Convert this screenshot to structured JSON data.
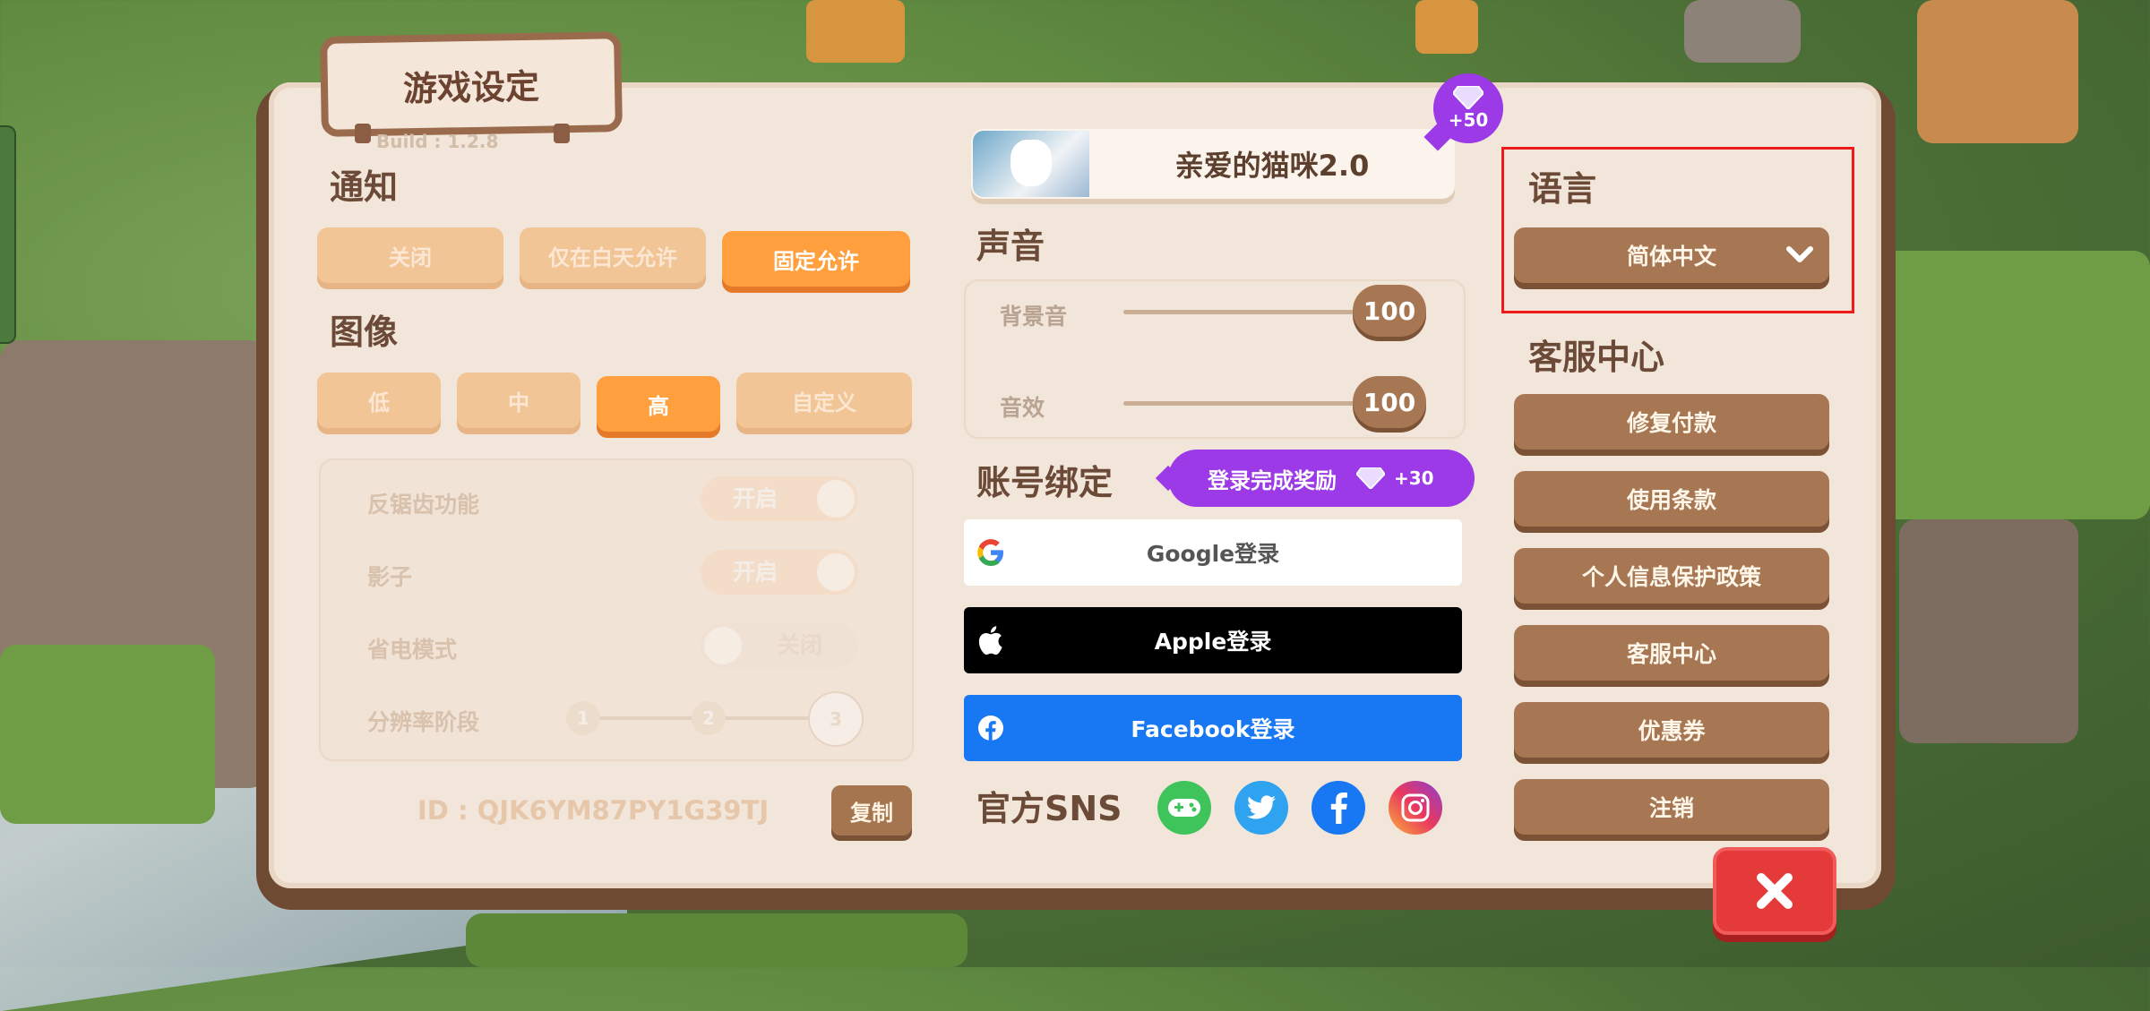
{
  "settings": {
    "title": "游戏设定",
    "build": "Build : 1.2.8",
    "notification": {
      "header": "通知",
      "options": [
        "关闭",
        "仅在白天允许",
        "固定允许"
      ],
      "selected": "固定允许"
    },
    "graphics": {
      "header": "图像",
      "options": [
        "低",
        "中",
        "高",
        "自定义"
      ],
      "selected": "高",
      "antialias_label": "反锯齿功能",
      "antialias_state": "开启",
      "shadow_label": "影子",
      "shadow_state": "开启",
      "powersave_label": "省电模式",
      "powersave_state": "关闭",
      "resolution_label": "分辨率阶段",
      "resolution_steps": [
        "1",
        "2",
        "3"
      ],
      "resolution_selected": "3"
    },
    "id_text": "ID : QJK6YM87PY1G39TJ",
    "copy_label": "复制"
  },
  "banner": {
    "title": "亲爱的猫咪2.0",
    "badge_amount": "+50"
  },
  "sound": {
    "header": "声音",
    "bgm_label": "背景音",
    "bgm_value": "100",
    "sfx_label": "音效",
    "sfx_value": "100"
  },
  "account": {
    "header": "账号绑定",
    "reward_label": "登录完成奖励",
    "reward_amount": "+30",
    "google_label": "Google登录",
    "apple_label": "Apple登录",
    "facebook_label": "Facebook登录"
  },
  "sns": {
    "header": "官方SNS",
    "icons": [
      "game-controller-icon",
      "twitter-icon",
      "facebook-icon",
      "instagram-icon"
    ]
  },
  "language": {
    "header": "语言",
    "selected": "简体中文"
  },
  "support": {
    "header": "客服中心",
    "buttons": [
      "修复付款",
      "使用条款",
      "个人信息保护政策",
      "客服中心",
      "优惠券",
      "注销"
    ]
  },
  "colors": {
    "accent_orange": "#ff9f3e",
    "brown": "#a77753",
    "purple": "#9b3ae6",
    "facebook_blue": "#1877f2",
    "close_red": "#e53a3a",
    "highlight": "#ee1a1a"
  }
}
